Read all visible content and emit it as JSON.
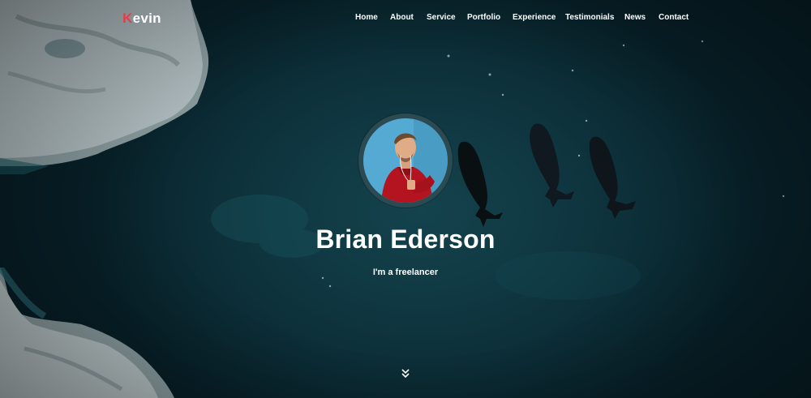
{
  "nav": {
    "logo_first": "K",
    "logo_rest": "evin",
    "items": [
      {
        "label": "Home"
      },
      {
        "label": "About"
      },
      {
        "label": "Service"
      },
      {
        "label": "Portfolio"
      },
      {
        "label": "Experience"
      },
      {
        "label": "Testimonials"
      },
      {
        "label": "News"
      },
      {
        "label": "Contact"
      }
    ]
  },
  "hero": {
    "name": "Brian Ederson",
    "tagline": "I'm a freelancer",
    "scroll_icon": "chevron-double-down-icon"
  },
  "colors": {
    "accent": "#e53c4b",
    "background": "#0b2a33",
    "text": "#ffffff"
  }
}
